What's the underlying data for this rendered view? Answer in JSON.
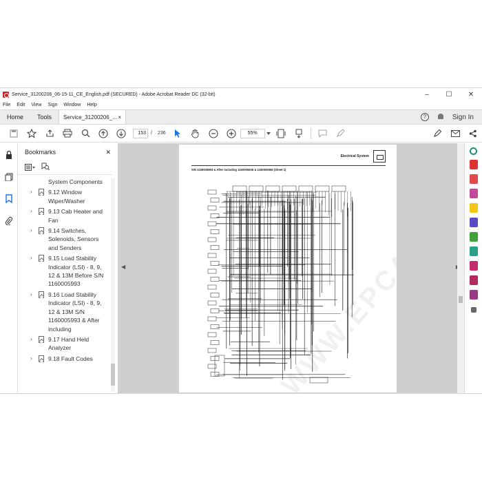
{
  "window": {
    "title": "Service_31200206_06-15-11_CE_English.pdf (SECURED) - Adobe Acrobat Reader DC (32-bit)",
    "controls": [
      "–",
      "☐",
      "✕"
    ]
  },
  "menu": [
    "File",
    "Edit",
    "View",
    "Sign",
    "Window",
    "Help"
  ],
  "tabs": {
    "home": "Home",
    "tools": "Tools",
    "document": "Service_31200206_...",
    "close": "×",
    "help": "?",
    "sign_in": "Sign In"
  },
  "toolbar": {
    "page_current": "153",
    "page_separator": "/",
    "page_total": "236",
    "zoom": "55%"
  },
  "bookmarks": {
    "title": "Bookmarks",
    "close": "✕",
    "items": [
      {
        "label": "System Components",
        "expandable": false
      },
      {
        "label": "9.12 Window Wiper/Washer",
        "expandable": true
      },
      {
        "label": "9.13 Cab Heater and Fan",
        "expandable": true
      },
      {
        "label": "9.14 Switches, Solenoids, Sensors and Senders",
        "expandable": true
      },
      {
        "label": "9.15 Load Stability Indicator (LSI) - 8, 9, 12 & 13M Before S/N 1160005993",
        "expandable": true
      },
      {
        "label": "9.16 Load Stability Indicator (LSI) - 8, 9, 12 & 13M S/N 1160005993 & After including",
        "expandable": true
      },
      {
        "label": "9.17 Hand Held Analyzer",
        "expandable": true
      },
      {
        "label": "9.18 Fault Codes",
        "expandable": true
      }
    ]
  },
  "document_page": {
    "header": "Electrical System",
    "subtitle": "S/N 1160005993 & After including 1160005945 & 1160005958 (Sheet 1)",
    "watermark": "WWW.EPCATALOGS.COM"
  },
  "colors": {
    "accent": "#1473e6",
    "viewer_bg": "#cfcfcf",
    "acrobat_red": "#d2232a"
  }
}
